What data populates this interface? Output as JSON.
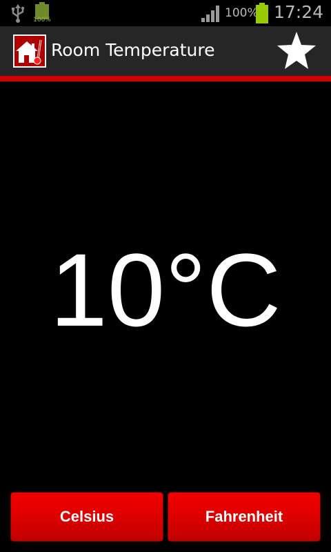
{
  "status_bar": {
    "sd_label": "100%",
    "battery_percent": "100%",
    "clock": "17:24",
    "icons": [
      "usb-icon",
      "sd-battery-icon",
      "signal-icon",
      "battery-icon"
    ],
    "battery_color": "#99cc00"
  },
  "action_bar": {
    "title": "Room Temperature",
    "app_icon": "house-thermometer-icon",
    "action_icon": "star-icon"
  },
  "temperature": {
    "value": "10°C"
  },
  "buttons": {
    "celsius_label": "Celsius",
    "fahrenheit_label": "Fahrenheit"
  },
  "colors": {
    "accent": "#d10000",
    "button_red": "#e00000",
    "background": "#000000",
    "action_bar": "#262626"
  }
}
